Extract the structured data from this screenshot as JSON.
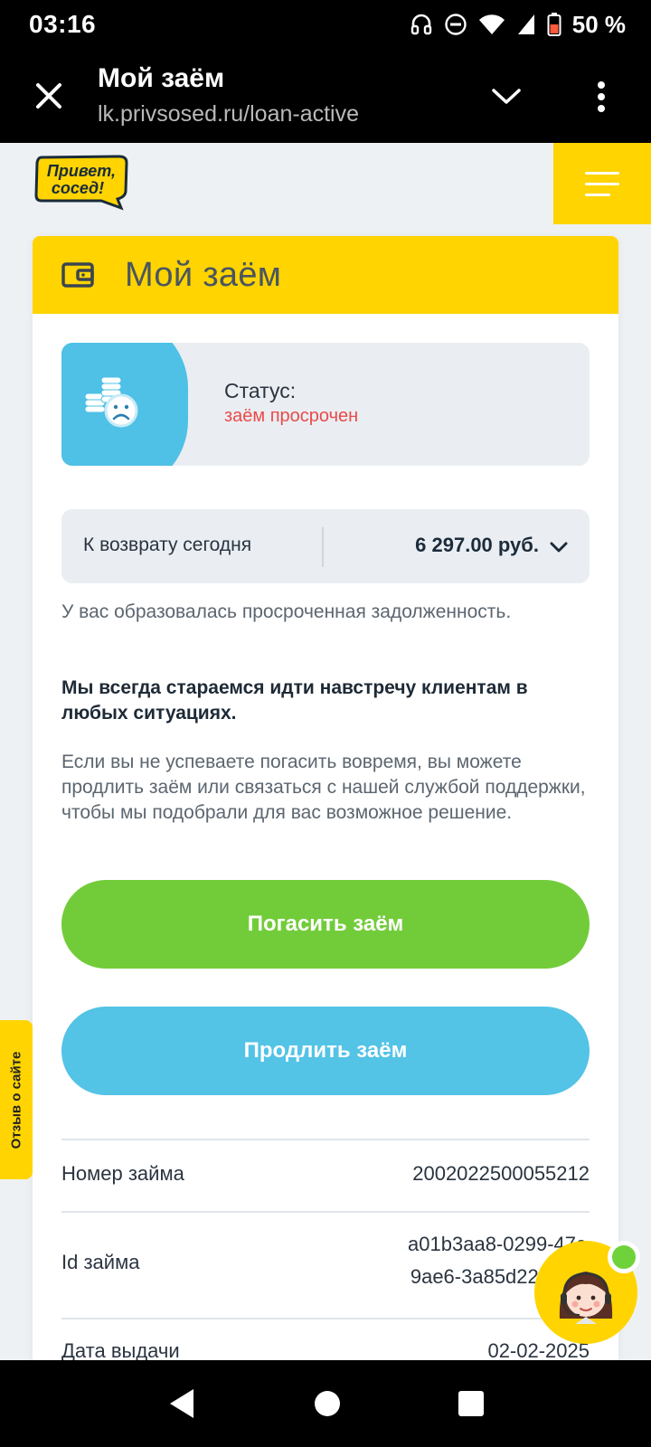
{
  "status_bar": {
    "time": "03:16",
    "battery": "50 %"
  },
  "browser": {
    "title": "Мой заём",
    "url": "lk.privsosed.ru/loan-active"
  },
  "site": {
    "logo_text_line1": "Привет,",
    "logo_text_line2": "сосед!"
  },
  "card": {
    "title": "Мой заём",
    "status_label": "Статус:",
    "status_value": "заём просрочен",
    "repay_label": "К возврату сегодня",
    "repay_amount": "6 297.00 руб.",
    "debt_text": "У вас образовалась просроченная задолженность.",
    "bold_text": "Мы всегда стараемся идти навстречу клиентам в любых ситуациях.",
    "info_text": "Если вы не успеваете погасить вовремя, вы можете продлить заём или связаться с нашей службой поддержки, чтобы мы подобрали для вас возможное решение.",
    "pay_button": "Погасить заём",
    "extend_button": "Продлить заём",
    "rows": [
      {
        "key": "Номер займа",
        "value": "2002022500055212"
      },
      {
        "key": "Id займа",
        "value_line1": "a01b3aa8-0299-47c",
        "value_line2": "9ae6-3a85d22e"
      },
      {
        "key": "Дата выдачи",
        "value": "02-02-2025"
      }
    ]
  },
  "feedback_tab": "Отзыв о сайте",
  "colors": {
    "brand_yellow": "#ffd400",
    "pay_green": "#72cc3a",
    "extend_blue": "#53c3e6",
    "overdue_red": "#ea4a4a"
  }
}
